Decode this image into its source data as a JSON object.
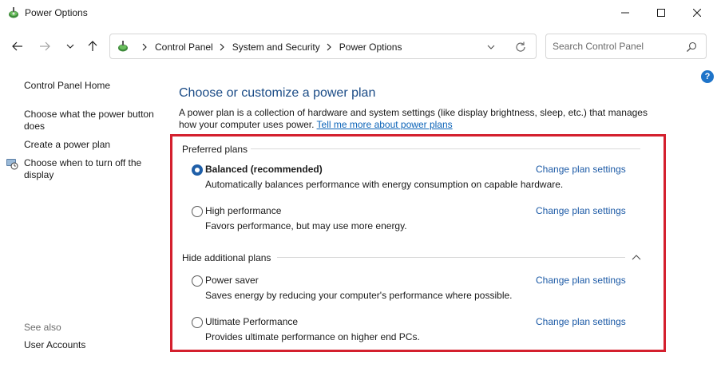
{
  "window": {
    "title": "Power Options",
    "icon": "power-options-icon",
    "controls": [
      "minimize-icon",
      "maximize-icon",
      "close-icon"
    ]
  },
  "navigation": {
    "breadcrumbs": [
      "Control Panel",
      "System and Security",
      "Power Options"
    ],
    "search_placeholder": "Search Control Panel"
  },
  "sidebar": {
    "home": "Control Panel Home",
    "links": [
      "Choose what the power button does",
      "Create a power plan",
      "Choose when to turn off the display"
    ],
    "see_also_heading": "See also",
    "see_also_links": [
      "User Accounts"
    ]
  },
  "main": {
    "title": "Choose or customize a power plan",
    "description": "A power plan is a collection of hardware and system settings (like display brightness, sleep, etc.) that manages how your computer uses power.",
    "more_link": "Tell me more about power plans",
    "preferred_heading": "Preferred plans",
    "additional_heading": "Hide additional plans",
    "change_label": "Change plan settings",
    "plans": [
      {
        "name": "Balanced (recommended)",
        "description": "Automatically balances performance with energy consumption on capable hardware.",
        "selected": true
      },
      {
        "name": "High performance",
        "description": "Favors performance, but may use more energy.",
        "selected": false
      },
      {
        "name": "Power saver",
        "description": "Saves energy by reducing your computer's performance where possible.",
        "selected": false
      },
      {
        "name": "Ultimate Performance",
        "description": "Provides ultimate performance on higher end PCs.",
        "selected": false
      }
    ]
  },
  "colors": {
    "highlight_border": "#d4202e",
    "link": "#1c5aa6",
    "title": "#1a4b86",
    "radio_selected": "#1f5fa8"
  }
}
